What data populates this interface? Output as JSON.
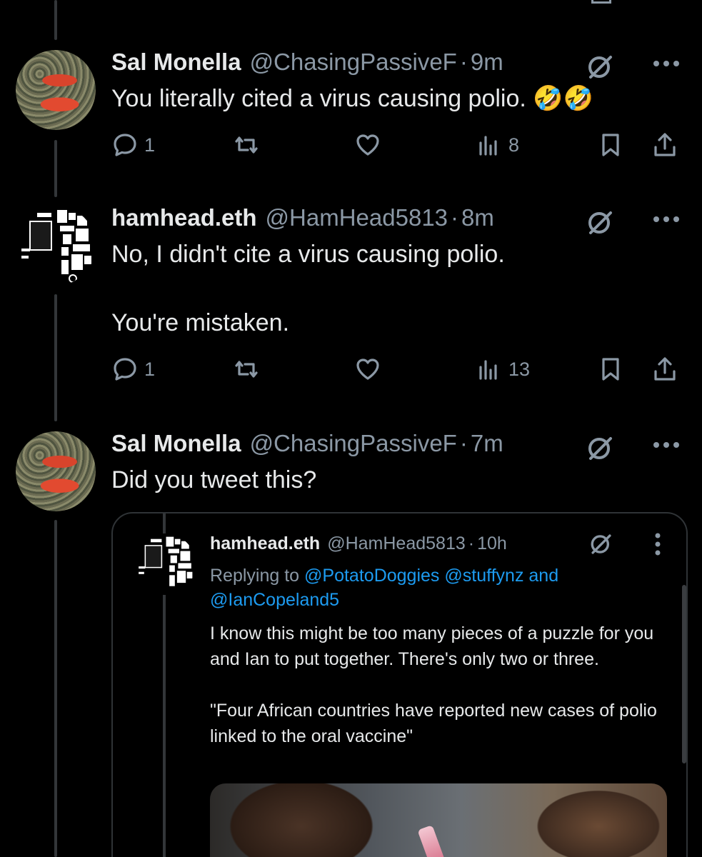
{
  "tweets": [
    {
      "name": "Sal Monella",
      "handle": "@ChasingPassiveF",
      "dot": "·",
      "time": "9m",
      "text": "You literally cited a virus causing polio. 🤣🤣",
      "replies": "1",
      "retweets": "",
      "likes": "",
      "views": "8"
    },
    {
      "name": "hamhead.eth",
      "handle": "@HamHead5813",
      "dot": "·",
      "time": "8m",
      "text": "No, I didn't cite a virus causing polio.\n\nYou're mistaken.",
      "replies": "1",
      "retweets": "",
      "likes": "",
      "views": "13"
    },
    {
      "name": "Sal Monella",
      "handle": "@ChasingPassiveF",
      "dot": "·",
      "time": "7m",
      "text": "Did you tweet this?"
    }
  ],
  "quote": {
    "name": "hamhead.eth",
    "handle": "@HamHead5813",
    "dot": "·",
    "time": "10h",
    "replying_prefix": "Replying to ",
    "mention1": "@PotatoDoggies",
    "mention2": " @stuffynz",
    "and": " and ",
    "mention3": "@IanCopeland5",
    "text": "I know this might be too many pieces of a puzzle for you and Ian to put together. There's only two or three.\n\n\"Four African countries have reported new cases of polio linked to the oral vaccine\""
  },
  "icons": {
    "reply": "reply-icon",
    "retweet": "retweet-icon",
    "like": "heart-icon",
    "views": "views-icon",
    "bookmark": "bookmark-icon",
    "share": "share-icon",
    "grok": "grok-icon",
    "more": "more-icon"
  },
  "colors": {
    "background": "#000000",
    "text": "#e7e9ea",
    "secondary": "#8b98a5",
    "accent": "#1d9bf0"
  }
}
